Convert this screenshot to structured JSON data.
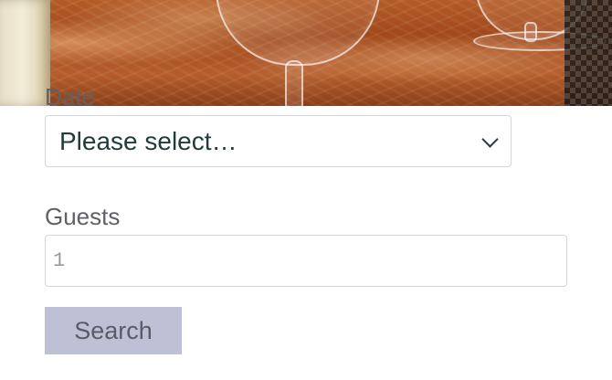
{
  "form": {
    "date_label": "Date",
    "date_value": "Please select…",
    "guests_label": "Guests",
    "guests_placeholder": "1",
    "search_label": "Search"
  },
  "icons": {
    "date_dropdown": "chevron-down-icon"
  },
  "colors": {
    "label_text": "#5f6166",
    "select_text": "#1f3c39",
    "input_border": "#d4d6dc",
    "button_background": "#bec1d5",
    "button_text": "#595c67"
  }
}
